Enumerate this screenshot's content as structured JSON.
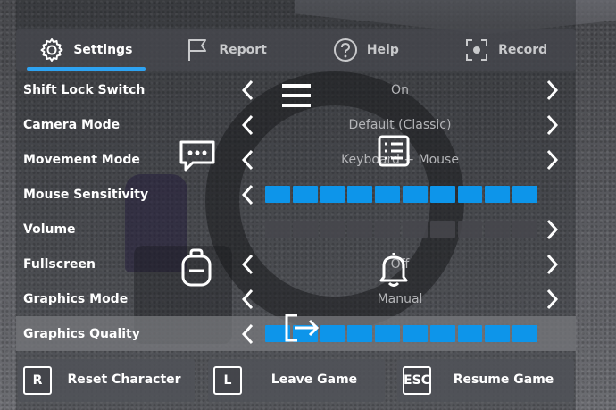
{
  "tabs": [
    {
      "label": "Settings",
      "icon": "gear-icon",
      "active": true
    },
    {
      "label": "Report",
      "icon": "flag-icon",
      "active": false
    },
    {
      "label": "Help",
      "icon": "question-icon",
      "active": false
    },
    {
      "label": "Record",
      "icon": "record-icon",
      "active": false
    }
  ],
  "settings": [
    {
      "label": "Shift Lock Switch",
      "value": "On"
    },
    {
      "label": "Camera Mode",
      "value": "Default (Classic)"
    },
    {
      "label": "Movement Mode",
      "value": "Keyboard + Mouse"
    },
    {
      "label": "Mouse Sensitivity",
      "slider_filled": 10,
      "slider_total": 10
    },
    {
      "label": "Volume",
      "slider_filled": 0,
      "slider_total": 10
    },
    {
      "label": "Fullscreen",
      "value": "Off"
    },
    {
      "label": "Graphics Mode",
      "value": "Manual"
    },
    {
      "label": "Graphics Quality",
      "slider_filled": 10,
      "slider_total": 10
    }
  ],
  "buttons": [
    {
      "key": "R",
      "label": "Reset Character"
    },
    {
      "key": "L",
      "label": "Leave Game"
    },
    {
      "key": "ESC",
      "label": "Resume Game"
    }
  ],
  "overlay_icons": [
    "menu-icon",
    "chat-icon",
    "playerlist-icon",
    "backpack-icon",
    "notification-bell-icon",
    "exit-icon"
  ],
  "colors": {
    "accent": "#0d95ea",
    "tab_underline": "#2ea3f2"
  }
}
